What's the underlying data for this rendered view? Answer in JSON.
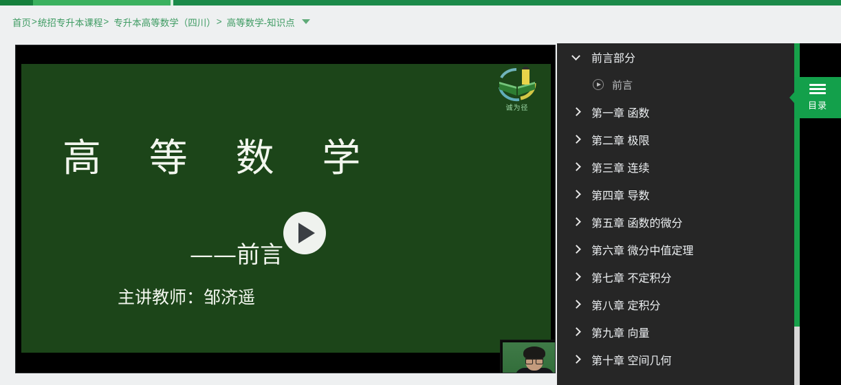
{
  "topbar": {
    "accent_dark": "#1b8a4a",
    "accent_light": "#3bb15f"
  },
  "breadcrumb": {
    "items": [
      {
        "label": "首页"
      },
      {
        "label": "统招专升本课程"
      },
      {
        "label": "专升本高等数学（四川）"
      },
      {
        "label": "高等数学-知识点"
      }
    ],
    "separator_1": ">",
    "separator_2": ">",
    "separator_3": ">",
    "dropdown_icon": "chevron-down-icon"
  },
  "player": {
    "slide": {
      "title": "高 等 数 学",
      "subtitle": "——前言",
      "teacher": "主讲教师：邹济遥"
    },
    "logo": {
      "text": "诚为径",
      "icon": "book-pencil-logo-icon"
    },
    "play_button": {
      "icon": "play-triangle-icon",
      "label": "播放"
    },
    "presenter": {
      "label": "讲师摄像头画面"
    }
  },
  "panel": {
    "background": "#262626",
    "scrollbar_color": "#17a04a",
    "rows": [
      {
        "type": "chapter",
        "label": "前言部分",
        "expanded": true
      },
      {
        "type": "lesson",
        "label": "前言"
      },
      {
        "type": "chapter",
        "label": "第一章 函数",
        "expanded": false
      },
      {
        "type": "chapter",
        "label": "第二章 极限",
        "expanded": false
      },
      {
        "type": "chapter",
        "label": "第三章 连续",
        "expanded": false
      },
      {
        "type": "chapter",
        "label": "第四章 导数",
        "expanded": false
      },
      {
        "type": "chapter",
        "label": "第五章 函数的微分",
        "expanded": false
      },
      {
        "type": "chapter",
        "label": "第六章 微分中值定理",
        "expanded": false
      },
      {
        "type": "chapter",
        "label": "第七章 不定积分",
        "expanded": false
      },
      {
        "type": "chapter",
        "label": "第八章 定积分",
        "expanded": false
      },
      {
        "type": "chapter",
        "label": "第九章 向量",
        "expanded": false
      },
      {
        "type": "chapter",
        "label": "第十章 空间几何",
        "expanded": false
      }
    ]
  },
  "catalog_tab": {
    "label": "目录",
    "icon": "hamburger-icon",
    "color": "#13a04b"
  }
}
